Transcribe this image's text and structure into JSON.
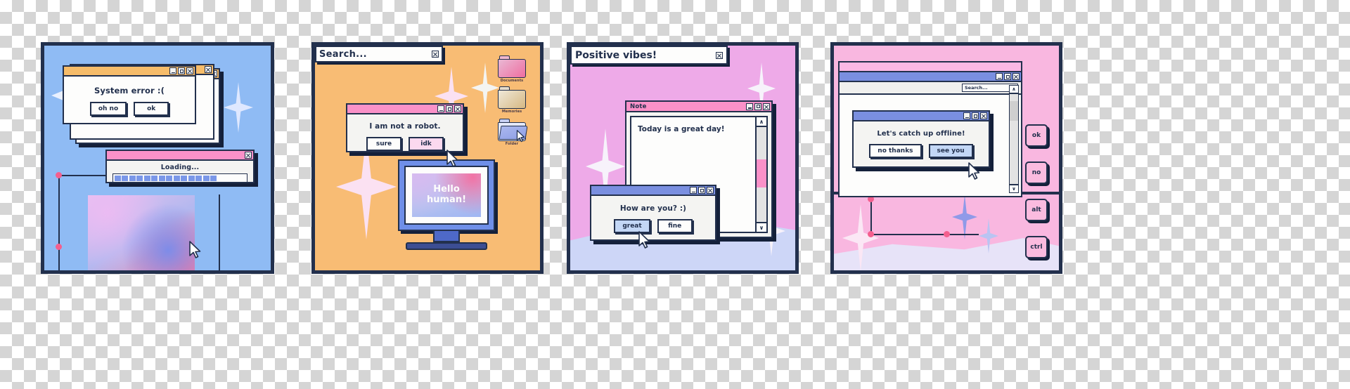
{
  "panels": [
    {
      "id": "panel-1",
      "bg_color": "#8fbbf4",
      "error_window": {
        "message": "System error :(",
        "buttons": [
          "oh no",
          "ok"
        ],
        "titlebar_color": "#f6bc6a"
      },
      "loading_window": {
        "message": "Loading...",
        "titlebar_color": "#fa91c8",
        "progress_blocks": 14
      }
    },
    {
      "id": "panel-2",
      "bg_color": "#f8bc74",
      "search": {
        "placeholder": "Search..."
      },
      "robot_window": {
        "message": "I am not a robot.",
        "buttons": [
          "sure",
          "idk"
        ],
        "titlebar_color": "#fa91c8"
      },
      "folders": [
        {
          "label": "Documents",
          "color": "#f07aa8"
        },
        {
          "label": "Memories",
          "color": "#dcc08c"
        },
        {
          "label": "Folder",
          "color": "#9fb0ec"
        }
      ],
      "monitor": {
        "line1": "Hello",
        "line2": "human!"
      }
    },
    {
      "id": "panel-3",
      "bg_color": "#eeaae8",
      "title_bar": {
        "text": "Positive vibes!"
      },
      "note_window": {
        "title": "Note",
        "content": "Today is a great day!",
        "titlebar_color": "#fa91c8"
      },
      "how_window": {
        "message": "How are you? :)",
        "buttons": [
          "great",
          "fine"
        ],
        "titlebar_color": "#7a8fe0"
      }
    },
    {
      "id": "panel-4",
      "bg_color": "#f9b7e0",
      "search": {
        "placeholder": "Search..."
      },
      "offline_window": {
        "message": "Let's catch up offline!",
        "buttons": [
          "no thanks",
          "see you"
        ],
        "titlebar_color": "#7a8fe0"
      },
      "keys": [
        "ok",
        "no",
        "alt",
        "ctrl"
      ]
    }
  ],
  "icons": {
    "minimize": "minimize-icon",
    "maximize": "maximize-icon",
    "close": "close-icon",
    "scroll_up": "∧",
    "scroll_down": "∨",
    "cursor": "mouse-cursor-icon",
    "sparkle": "sparkle-icon",
    "folder": "folder-icon"
  }
}
